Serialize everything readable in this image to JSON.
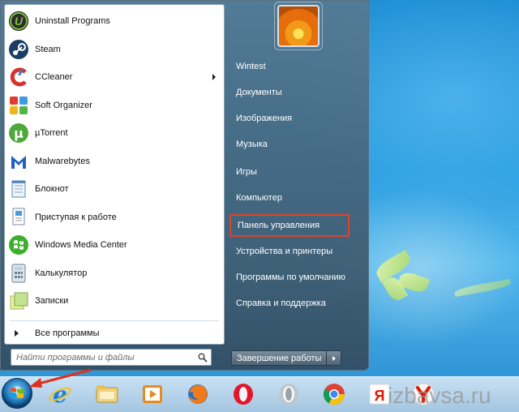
{
  "start_menu": {
    "programs": [
      {
        "label": "Uninstall Programs",
        "icon": "uninstall-programs-icon",
        "has_submenu": false
      },
      {
        "label": "Steam",
        "icon": "steam-icon",
        "has_submenu": false
      },
      {
        "label": "CCleaner",
        "icon": "ccleaner-icon",
        "has_submenu": true
      },
      {
        "label": "Soft Organizer",
        "icon": "soft-organizer-icon",
        "has_submenu": false
      },
      {
        "label": "µTorrent",
        "icon": "utorrent-icon",
        "has_submenu": false
      },
      {
        "label": "Malwarebytes",
        "icon": "malwarebytes-icon",
        "has_submenu": false
      },
      {
        "label": "Блокнот",
        "icon": "notepad-icon",
        "has_submenu": false
      },
      {
        "label": "Приступая к работе",
        "icon": "getting-started-icon",
        "has_submenu": false
      },
      {
        "label": "Windows Media Center",
        "icon": "media-center-icon",
        "has_submenu": false
      },
      {
        "label": "Калькулятор",
        "icon": "calculator-icon",
        "has_submenu": false
      },
      {
        "label": "Записки",
        "icon": "sticky-notes-icon",
        "has_submenu": false
      }
    ],
    "all_programs_label": "Все программы",
    "search_placeholder": "Найти программы и файлы",
    "right_items": [
      {
        "label": "Wintest",
        "highlighted": false
      },
      {
        "label": "Документы",
        "highlighted": false
      },
      {
        "label": "Изображения",
        "highlighted": false
      },
      {
        "label": "Музыка",
        "highlighted": false
      },
      {
        "label": "Игры",
        "highlighted": false
      },
      {
        "label": "Компьютер",
        "highlighted": false
      },
      {
        "label": "Панель управления",
        "highlighted": true
      },
      {
        "label": "Устройства и принтеры",
        "highlighted": false
      },
      {
        "label": "Программы по умолчанию",
        "highlighted": false
      },
      {
        "label": "Справка и поддержка",
        "highlighted": false
      }
    ],
    "shutdown_label": "Завершение работы"
  },
  "taskbar": {
    "icons": [
      "ie-icon",
      "explorer-icon",
      "media-player-icon",
      "firefox-icon",
      "opera-icon",
      "opera-neon-icon",
      "chrome-icon",
      "yandex-icon",
      "yandex-browser-icon"
    ],
    "yandex_letter": "Я"
  },
  "watermark": "izbavsa.ru",
  "colors": {
    "highlight_border": "#d9452b",
    "annotation_arrow": "#e0311e"
  }
}
